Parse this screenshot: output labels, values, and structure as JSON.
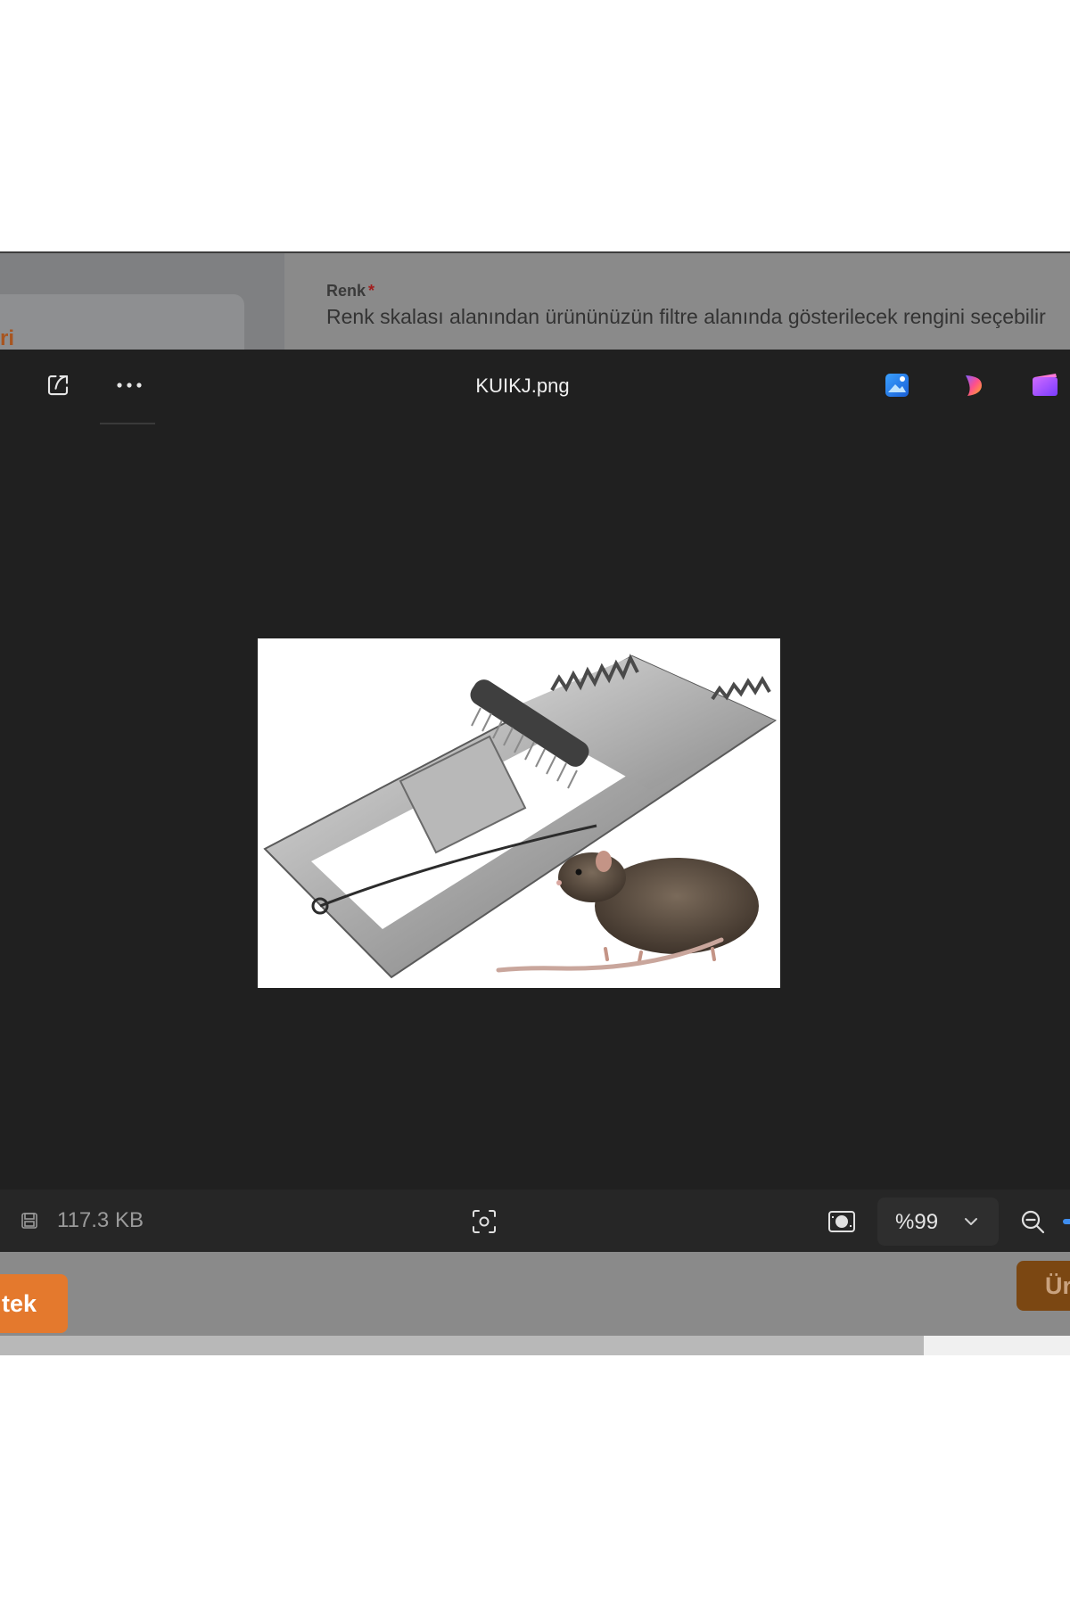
{
  "background_page": {
    "card_partial_text": "ri",
    "field_label": "Renk",
    "required_marker": "*",
    "field_description": "Renk skalası alanından ürününüzün filtre alanında gösterilecek rengini seçebilir",
    "add_button_partial": "tek",
    "product_button_partial": "Ür"
  },
  "viewer": {
    "file_name": "KUIKJ.png",
    "toolbar_icons": [
      "share-icon",
      "more-options-icon",
      "photos-editor-icon",
      "copilot-icon",
      "clipchamp-icon"
    ],
    "file_size": "117.3 KB",
    "zoom": {
      "value": "%99",
      "options_icon": "chevron-down-icon"
    },
    "image_subject": "mouse trap with rat"
  },
  "colors": {
    "viewer_bg": "#202020",
    "statusbar_bg": "#262626",
    "accent_orange": "#e4792d",
    "required_red": "#a21d1d"
  }
}
